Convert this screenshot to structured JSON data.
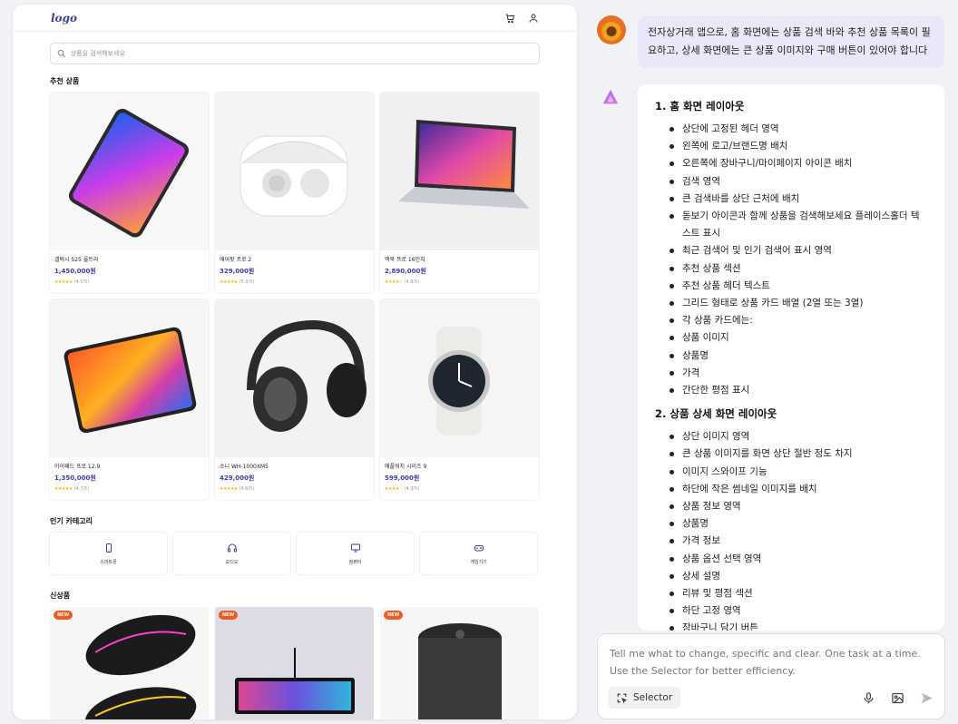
{
  "app": {
    "logo": "logo",
    "search_placeholder": "상품을 검색해보세요",
    "sections": {
      "recommended": "추천 상품",
      "categories": "인기 카테고리",
      "new_products": "신상품"
    },
    "products": [
      {
        "name": "갤럭시 S25 울트라",
        "price": "1,450,000원",
        "stars": "★★★★★",
        "rating": "(4.5/5)",
        "icon": "tablet-phone-image"
      },
      {
        "name": "에어팟 프로 2",
        "price": "329,000원",
        "stars": "★★★★★",
        "rating": "(5.0/5)",
        "icon": "earbuds-image"
      },
      {
        "name": "맥북 프로 16인치",
        "price": "2,890,000원",
        "stars": "★★★★☆",
        "rating": "(4.8/5)",
        "icon": "laptop-image"
      },
      {
        "name": "아이패드 프로 12.9",
        "price": "1,350,000원",
        "stars": "★★★★★",
        "rating": "(4.7/5)",
        "icon": "tablet-image"
      },
      {
        "name": "소니 WH-1000XM5",
        "price": "429,000원",
        "stars": "★★★★★",
        "rating": "(4.6/5)",
        "icon": "headphones-image"
      },
      {
        "name": "애플워치 시리즈 9",
        "price": "599,000원",
        "stars": "★★★★☆",
        "rating": "(4.3/5)",
        "icon": "watch-image"
      }
    ],
    "categories": [
      {
        "label": "스마트폰",
        "icon": "smartphone-icon"
      },
      {
        "label": "오디오",
        "icon": "headphones-icon"
      },
      {
        "label": "컴퓨터",
        "icon": "monitor-icon"
      },
      {
        "label": "게임기기",
        "icon": "gamepad-icon"
      }
    ],
    "new_badge": "NEW",
    "new_products": [
      {
        "icon": "gaming-mouse-image"
      },
      {
        "icon": "keyboard-image"
      },
      {
        "icon": "speaker-image"
      }
    ],
    "colors": {
      "accent": "#3c40a8",
      "badge": "#f25a1e",
      "star": "#f3b419"
    }
  },
  "chat": {
    "user_message": "전자상거래 앱으로, 홈 화면에는 상품 검색 바와 추천 상품 목록이 필요하고, 상세 화면에는 큰 상품 이미지와 구매 버튼이 있어야 합니다",
    "sections": [
      {
        "heading": "1. 홈 화면 레이아웃",
        "items": [
          "상단에 고정된 헤더 영역",
          "왼쪽에 로고/브랜드명 배치",
          "오른쪽에 장바구니/마이페이지 아이콘 배치",
          "검색 영역",
          "큰 검색바를 상단 근처에 배치",
          "돋보기 아이콘과 함께 상품을 검색해보세요 플레이스홀더 텍스트 표시",
          "최근 검색어 및 인기 검색어 표시 영역",
          "추천 상품 섹션",
          "추천 상품 헤더 텍스트",
          "그리드 형태로 상품 카드 배열 (2열 또는 3열)",
          "각 상품 카드에는:",
          "상품 이미지",
          "상품명",
          "가격",
          "간단한 평점 표시"
        ]
      },
      {
        "heading": "2. 상품 상세 화면 레이아웃",
        "items": [
          "상단 이미지 영역",
          "큰 상품 이미지를 화면 상단 절반 정도 차지",
          "이미지 스와이프 기능",
          "하단에 작은 썸네일 이미지를 배치",
          "상품 정보 영역",
          "상품명",
          "가격 정보",
          "상품 옵션 선택 영역",
          "상세 설명",
          "리뷰 및 평점 섹션",
          "하단 고정 영역",
          "장바구니 담기 버튼"
        ]
      }
    ],
    "composer_placeholder": "Tell me what to change, specific and clear. One task at a time.\nUse the Selector for better efficiency.",
    "selector_label": "Selector"
  }
}
